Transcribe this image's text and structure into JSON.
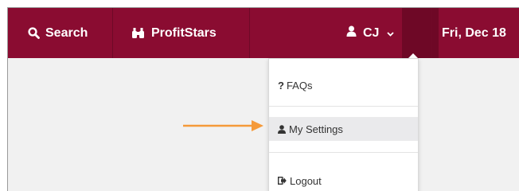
{
  "navbar": {
    "search_label": "Search",
    "profitstars_label": "ProfitStars",
    "user_label": "CJ",
    "date_label": "Fri, Dec 18",
    "icons": {
      "search": "search-icon",
      "profitstars": "binoculars-icon",
      "user": "user-icon",
      "user_menu": "chevron-down-icon"
    }
  },
  "user_menu": {
    "items": [
      {
        "label": "FAQs",
        "prefix": "?",
        "icon": "question-icon"
      },
      {
        "label": "My Settings",
        "icon": "user-icon",
        "highlighted": true
      },
      {
        "label": "Logout",
        "icon": "logout-icon"
      }
    ]
  },
  "annotation": {
    "icon": "orange-arrow"
  },
  "colors": {
    "navbar": "#8a0c31",
    "navbar_active": "#6e0826",
    "background": "#f1f1f1",
    "highlight": "#eaeaec",
    "arrow": "#f59a3a"
  }
}
